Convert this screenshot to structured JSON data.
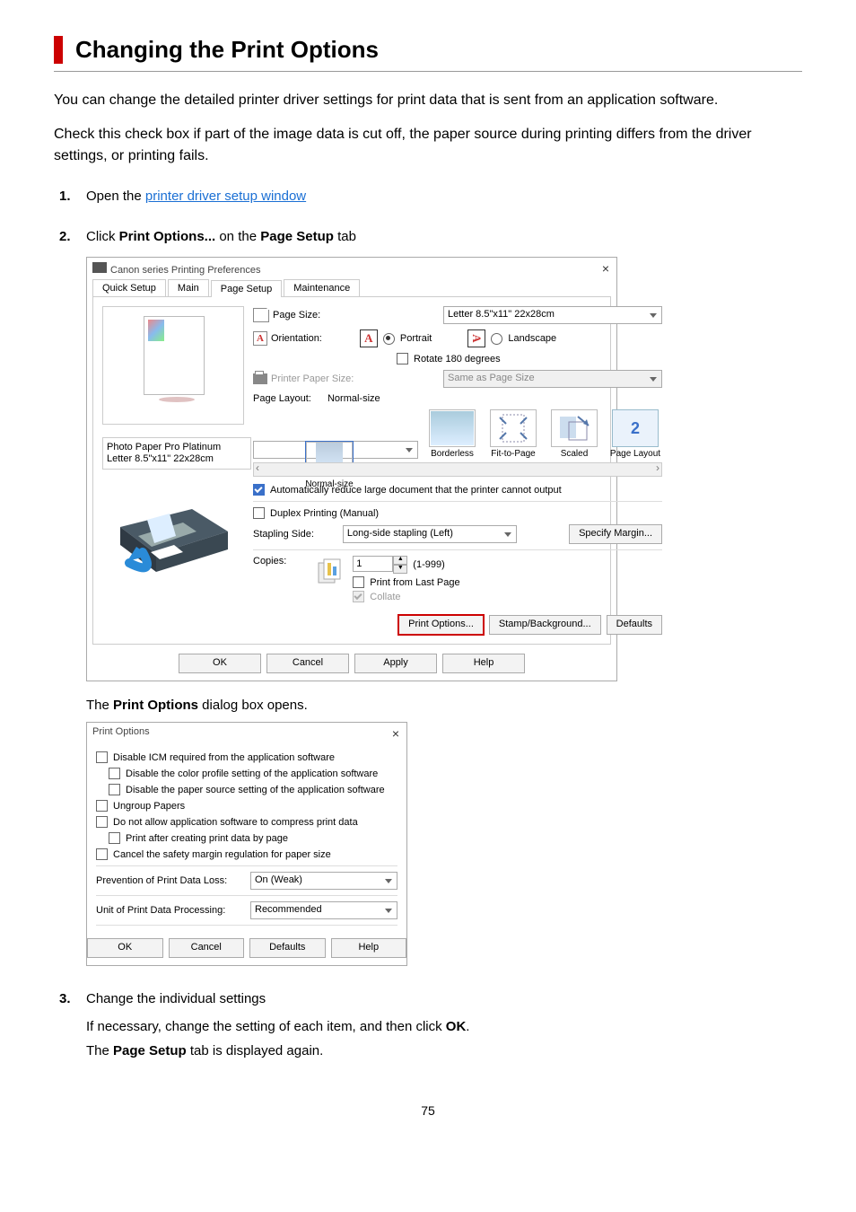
{
  "heading": "Changing the Print Options",
  "intro1": "You can change the detailed printer driver settings for print data that is sent from an application software.",
  "intro2": "Check this check box if part of the image data is cut off, the paper source during printing differs from the driver settings, or printing fails.",
  "steps": {
    "s1": {
      "prefix": "Open the ",
      "link": "printer driver setup window"
    },
    "s2": {
      "t1": "Click ",
      "b1": "Print Options...",
      "t2": " on the ",
      "b2": "Page Setup",
      "t3": " tab",
      "after": {
        "t1": "The ",
        "b1": "Print Options",
        "t2": " dialog box opens."
      }
    },
    "s3": {
      "title": "Change the individual settings",
      "line1a": "If necessary, change the setting of each item, and then click ",
      "line1b": "OK",
      "line1c": ".",
      "line2a": "The ",
      "line2b": "Page Setup",
      "line2c": " tab is displayed again."
    }
  },
  "ps": {
    "title": "Canon          series Printing Preferences",
    "tabs": [
      "Quick Setup",
      "Main",
      "Page Setup",
      "Maintenance"
    ],
    "left": {
      "cap1": "Photo Paper Pro Platinum",
      "cap2": "Letter 8.5\"x11\" 22x28cm"
    },
    "right": {
      "page_size_lbl": "Page Size:",
      "page_size_val": "Letter 8.5\"x11\" 22x28cm",
      "orient_lbl": "Orientation:",
      "orient_portrait": "Portrait",
      "orient_landscape": "Landscape",
      "rotate_lbl": "Rotate 180 degrees",
      "printer_paper_lbl": "Printer Paper Size:",
      "printer_paper_val": "Same as Page Size",
      "layout_lbl": "Page Layout:",
      "layout_val": "Normal-size",
      "thumbs": [
        "Normal-size",
        "Borderless",
        "Fit-to-Page",
        "Scaled",
        "Page Layout"
      ],
      "auto_reduce": "Automatically reduce large document that the printer cannot output",
      "duplex": "Duplex Printing (Manual)",
      "stapling_lbl": "Stapling Side:",
      "stapling_val": "Long-side stapling (Left)",
      "specify_margin": "Specify Margin...",
      "copies_lbl": "Copies:",
      "copies_val": "1",
      "copies_range": "(1-999)",
      "print_last": "Print from Last Page",
      "collate": "Collate",
      "print_options_btn": "Print Options...",
      "stamp_btn": "Stamp/Background...",
      "defaults_btn": "Defaults"
    },
    "foot": {
      "ok": "OK",
      "cancel": "Cancel",
      "apply": "Apply",
      "help": "Help"
    }
  },
  "po": {
    "title": "Print Options",
    "items": [
      "Disable ICM required from the application software",
      "Disable the color profile setting of the application software",
      "Disable the paper source setting of the application software",
      "Ungroup Papers",
      "Do not allow application software to compress print data",
      "Print after creating print data by page",
      "Cancel the safety margin regulation for paper size"
    ],
    "prevention_lbl": "Prevention of Print Data Loss:",
    "prevention_val": "On (Weak)",
    "unit_lbl": "Unit of Print Data Processing:",
    "unit_val": "Recommended",
    "ok": "OK",
    "cancel": "Cancel",
    "defaults": "Defaults",
    "help": "Help"
  },
  "pagenum": "75"
}
